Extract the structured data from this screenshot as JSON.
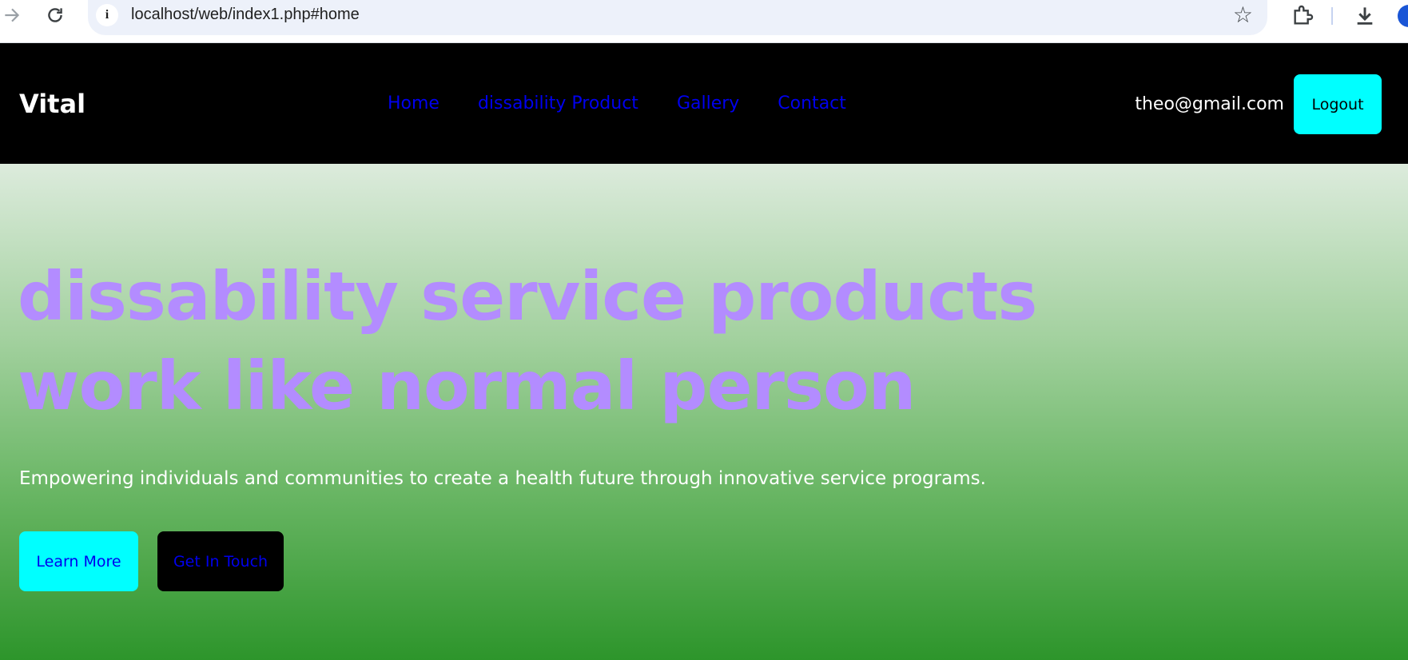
{
  "browser": {
    "url": "localhost/web/index1.php#home",
    "icons": [
      "forward-icon",
      "reload-icon",
      "site-info-icon",
      "star-icon",
      "extensions-icon",
      "download-icon",
      "profile-icon"
    ]
  },
  "header": {
    "brand": "Vital",
    "nav": [
      {
        "label": "Home"
      },
      {
        "label": "dissability Product"
      },
      {
        "label": "Gallery"
      },
      {
        "label": "Contact"
      }
    ],
    "user_email": "theo@gmail.com",
    "logout_label": "Logout"
  },
  "hero": {
    "title_line1": "dissability service products",
    "title_line2": "work like normal person",
    "subtitle": "Empowering individuals and communities to create a health future through innovative service programs.",
    "learn_more_label": "Learn More",
    "get_in_touch_label": "Get In Touch"
  },
  "colors": {
    "header_bg": "#000000",
    "accent_cyan": "#00ffff",
    "link_blue": "#0000ee",
    "title_purple": "#b38cff",
    "hero_gradient_top": "#dcebdc",
    "hero_gradient_bottom": "#2d952b"
  }
}
